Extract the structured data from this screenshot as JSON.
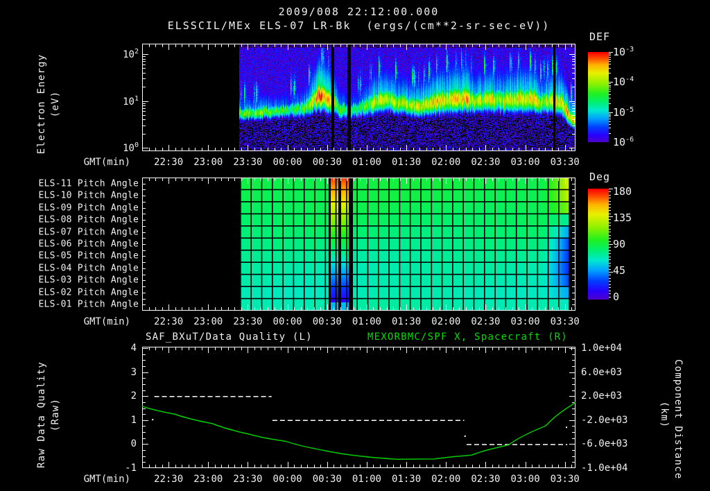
{
  "header": {
    "title_datetime": "2009/008 22:12:00.000",
    "title_instrument": "ELSSCIL/MEx ELS-07 LR-Bk  (ergs/(cm**2-sr-sec-eV))"
  },
  "time_axis": {
    "label": "GMT(min)",
    "start_hours": 22.1667,
    "end_hours": 27.6333,
    "tick_hours": [
      22.5,
      23.0,
      23.5,
      24.0,
      24.5,
      25.0,
      25.5,
      26.0,
      26.5,
      27.0,
      27.5
    ],
    "tick_labels": [
      "22:30",
      "23:00",
      "23:30",
      "00:00",
      "00:30",
      "01:00",
      "01:30",
      "02:00",
      "02:30",
      "03:00",
      "03:30"
    ]
  },
  "top_panel": {
    "ylabel_line1": "Electron Energy",
    "ylabel_line2": "(eV)",
    "y_tick_exponents": [
      2,
      1,
      0
    ],
    "colorbar": {
      "title": "DEF",
      "tick_exponents": [
        -3,
        -4,
        -5,
        -6
      ],
      "units": "ergs/(cm**2-sr-sec-eV)"
    }
  },
  "pitch_panel": {
    "row_labels": [
      "ELS-11 Pitch Angle",
      "ELS-10 Pitch Angle",
      "ELS-09 Pitch Angle",
      "ELS-08 Pitch Angle",
      "ELS-07 Pitch Angle",
      "ELS-06 Pitch Angle",
      "ELS-05 Pitch Angle",
      "ELS-04 Pitch Angle",
      "ELS-03 Pitch Angle",
      "ELS-02 Pitch Angle",
      "ELS-01 Pitch Angle"
    ],
    "colorbar": {
      "title": "Deg",
      "tick_labels": [
        "180",
        "135",
        "90",
        "45",
        "0"
      ]
    }
  },
  "bottom_panel": {
    "left_title": "SAF_BXuT/Data Quality (L)",
    "right_title": "MEXORBMC/SPF X, Spacecraft (R)",
    "left_axis": {
      "label_line1": "Raw Data Quality",
      "label_line2": "(Raw)",
      "tick_labels": [
        "4",
        "3",
        "2",
        "1",
        "0",
        "-1"
      ],
      "range": [
        -1,
        4
      ]
    },
    "right_axis": {
      "label_line1": "Component Distance",
      "label_line2": "(km)",
      "tick_labels": [
        "1.0e+04",
        "6.0e+03",
        "2.0e+03",
        "-2.0e+03",
        "-6.0e+03",
        "-1.0e+04"
      ],
      "range": [
        -10000,
        10000
      ]
    }
  },
  "colors": {
    "background": "#000000",
    "frame_white": "#ffffff",
    "text_white": "#f2f2f2",
    "series_green": "#00cc00",
    "title_green": "#00dd00",
    "grid_black": "#000000"
  },
  "colormap": [
    [
      0.0,
      "#000000"
    ],
    [
      0.07,
      "#1a0040"
    ],
    [
      0.13,
      "#5000c8"
    ],
    [
      0.2,
      "#2800ff"
    ],
    [
      0.28,
      "#0040ff"
    ],
    [
      0.36,
      "#00a0ff"
    ],
    [
      0.44,
      "#00e8d0"
    ],
    [
      0.52,
      "#00f070"
    ],
    [
      0.6,
      "#20f020"
    ],
    [
      0.7,
      "#90f000"
    ],
    [
      0.8,
      "#e8f000"
    ],
    [
      0.88,
      "#ffb000"
    ],
    [
      0.94,
      "#ff5000"
    ],
    [
      1.0,
      "#ff0000"
    ]
  ],
  "chart_data": [
    {
      "type": "heatmap",
      "name": "electron-energy-spectrogram",
      "title": "ELSSCIL/MEx ELS-07 LR-Bk",
      "units": "ergs/(cm**2-sr-sec-eV)",
      "value_scale_log10": [
        -6,
        -3
      ],
      "energy_range_ev": [
        1,
        165
      ],
      "data_start_hours": 23.391,
      "seed": 42,
      "band_profile": [
        {
          "t": 23.391,
          "e": 5.5,
          "dw": 0.18,
          "p": 0.62
        },
        {
          "t": 23.654,
          "e": 5.9,
          "dw": 0.19,
          "p": 0.66
        },
        {
          "t": 23.916,
          "e": 6.1,
          "dw": 0.18,
          "p": 0.6
        },
        {
          "t": 24.047,
          "e": 6.5,
          "dw": 0.21,
          "p": 0.55
        },
        {
          "t": 24.222,
          "e": 7.2,
          "dw": 0.24,
          "p": 0.6
        },
        {
          "t": 24.397,
          "e": 12.9,
          "dw": 0.39,
          "p": 0.92
        },
        {
          "t": 24.528,
          "e": 10.9,
          "dw": 0.36,
          "p": 0.85
        },
        {
          "t": 24.659,
          "e": 6.5,
          "dw": 0.24,
          "p": 0.6
        },
        {
          "t": 24.878,
          "e": 6.5,
          "dw": 0.22,
          "p": 0.55
        },
        {
          "t": 25.053,
          "e": 9.2,
          "dw": 0.3,
          "p": 0.72
        },
        {
          "t": 25.228,
          "e": 10.9,
          "dw": 0.33,
          "p": 0.75
        },
        {
          "t": 25.403,
          "e": 9.2,
          "dw": 0.3,
          "p": 0.7
        },
        {
          "t": 25.621,
          "e": 7.8,
          "dw": 0.27,
          "p": 0.78
        },
        {
          "t": 25.84,
          "e": 9.2,
          "dw": 0.33,
          "p": 0.82
        },
        {
          "t": 26.059,
          "e": 10.9,
          "dw": 0.36,
          "p": 0.8
        },
        {
          "t": 26.277,
          "e": 11.7,
          "dw": 0.36,
          "p": 0.85
        },
        {
          "t": 26.365,
          "e": 9.2,
          "dw": 0.3,
          "p": 0.7
        },
        {
          "t": 26.496,
          "e": 10.9,
          "dw": 0.33,
          "p": 0.78
        },
        {
          "t": 26.715,
          "e": 10.2,
          "dw": 0.33,
          "p": 0.72
        },
        {
          "t": 26.933,
          "e": 10.9,
          "dw": 0.36,
          "p": 0.8
        },
        {
          "t": 27.065,
          "e": 11.7,
          "dw": 0.36,
          "p": 0.82
        },
        {
          "t": 27.196,
          "e": 9.2,
          "dw": 0.3,
          "p": 0.72
        },
        {
          "t": 27.327,
          "e": 10.2,
          "dw": 0.33,
          "p": 0.78
        },
        {
          "t": 27.458,
          "e": 9.2,
          "dw": 0.33,
          "p": 0.8
        },
        {
          "t": 27.546,
          "e": 4.6,
          "dw": 0.24,
          "p": 0.85
        },
        {
          "t": 27.633,
          "e": 4.0,
          "dw": 0.21,
          "p": 0.8
        }
      ],
      "data_gaps_hours": [
        [
          24.554,
          24.589
        ],
        [
          24.747,
          24.799
        ],
        [
          27.345,
          27.371
        ]
      ]
    },
    {
      "type": "heatmap",
      "name": "pitch-angle-panel",
      "rows": 11,
      "value_scale_deg": [
        0,
        180
      ],
      "data_start_hours": 23.399,
      "data_end_hours": 27.563,
      "row_base_deg": [
        101,
        100,
        98,
        96,
        93,
        90,
        87,
        85,
        84,
        83,
        85
      ],
      "right_feature_start_hours": 27.196,
      "right_feature_deg": [
        145,
        140,
        125,
        85,
        62,
        48,
        45,
        44,
        50,
        65,
        80
      ],
      "stripe_regions_hours": [
        [
          24.545,
          24.641
        ],
        [
          24.676,
          24.772
        ]
      ],
      "stripe_top_deg": 172,
      "stripe_bottom_deg": 24,
      "black_gaps_hours": [
        [
          24.519,
          24.545
        ],
        [
          24.641,
          24.676
        ],
        [
          24.772,
          24.825
        ]
      ]
    },
    {
      "type": "line",
      "name": "quality-and-distance",
      "left_ylim": [
        -1,
        4
      ],
      "right_ylim": [
        -10000,
        10000
      ],
      "series": [
        {
          "name": "SAF_BXuT/Data Quality (L)",
          "axis": "left",
          "style": "dashed",
          "color": "#ffffff",
          "segments": [
            {
              "value": 2,
              "t_start": 22.32,
              "t_end": 23.8
            },
            {
              "value": 1,
              "t_start": 23.81,
              "t_end": 26.23
            },
            {
              "value": 0,
              "t_start": 26.26,
              "t_end": 27.53
            }
          ],
          "dots": [
            {
              "t": 22.3,
              "v": 1.02
            },
            {
              "t": 26.24,
              "v": 0.33
            },
            {
              "t": 27.52,
              "v": 0.7
            }
          ]
        },
        {
          "name": "MEXORBMC/SPF X, Spacecraft (R)",
          "axis": "right",
          "style": "solid",
          "color": "#00cc00",
          "t": [
            22.167,
            22.587,
            23.059,
            23.522,
            23.986,
            24.458,
            24.922,
            25.385,
            25.858,
            26.321,
            26.785,
            27.257,
            27.607,
            27.633
          ],
          "km": [
            280,
            -1040,
            -2600,
            -4360,
            -5560,
            -7040,
            -8000,
            -8520,
            -8480,
            -7840,
            -6160,
            -2960,
            720,
            1000
          ]
        }
      ]
    }
  ]
}
